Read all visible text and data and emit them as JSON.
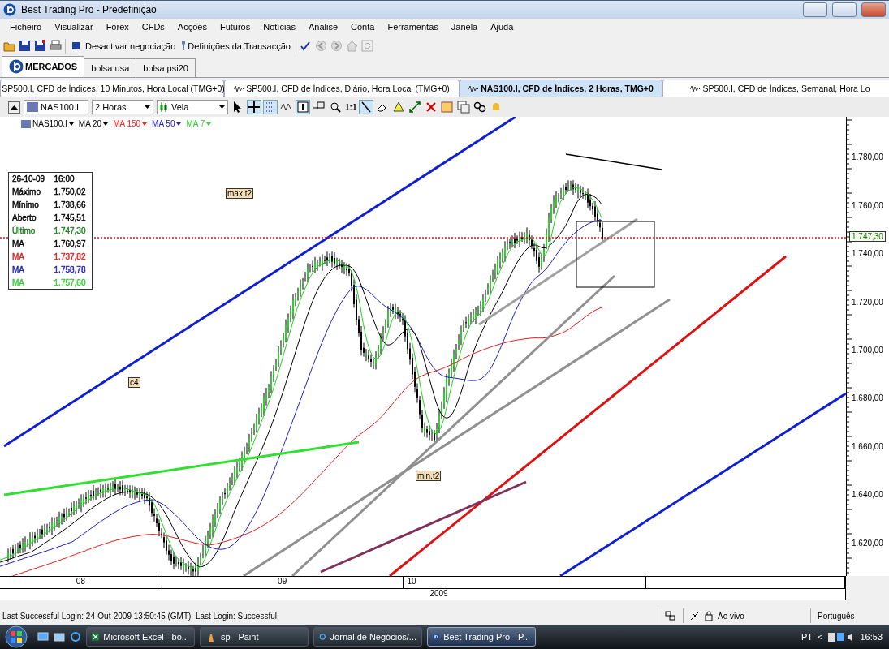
{
  "window": {
    "title": "Best Trading Pro - Predefinição"
  },
  "menu": [
    "Ficheiro",
    "Visualizar",
    "Forex",
    "CFDs",
    "Acções",
    "Futuros",
    "Notícias",
    "Análise",
    "Conta",
    "Ferramentas",
    "Janela",
    "Ajuda"
  ],
  "toolbar": {
    "buttons": [
      {
        "kind": "open"
      },
      {
        "kind": "save"
      },
      {
        "kind": "saveall"
      },
      {
        "kind": "print"
      },
      {
        "kind": "stop",
        "label": "Desactivar negociação"
      },
      {
        "kind": "settings",
        "label": "Definições da Transacção"
      },
      {
        "kind": "check"
      },
      {
        "kind": "back"
      },
      {
        "kind": "forward"
      },
      {
        "kind": "home"
      },
      {
        "kind": "refresh"
      }
    ]
  },
  "market_tabs": [
    {
      "label": "MERCADOS",
      "selected": true
    },
    {
      "label": "bolsa usa",
      "selected": false
    },
    {
      "label": "bolsa psi20",
      "selected": false
    }
  ],
  "chart_tabs": [
    {
      "label": "SP500.I, CFD de Índices, 10 Minutos, Hora Local (TMG+0)",
      "selected": false
    },
    {
      "label": "SP500.I, CFD de Índices, Diário, Hora Local (TMG+0)",
      "selected": false
    },
    {
      "label": "NAS100.I, CFD de Índices, 2 Horas, TMG+0",
      "selected": true
    },
    {
      "label": "SP500.I, CFD de Índices, Semanal, Hora Lo",
      "selected": false
    }
  ],
  "chart_toolbar": {
    "symbol": "NAS100.I",
    "period": "2 Horas",
    "chart_type": "Vela",
    "ratio": "1:1"
  },
  "legend": [
    {
      "label": "NAS100.I",
      "color": "#000000"
    },
    {
      "label": "MA 20",
      "color": "#000000"
    },
    {
      "label": "MA 150",
      "color": "#ff2020"
    },
    {
      "label": "MA 50",
      "color": "#2020d0"
    },
    {
      "label": "MA 7",
      "color": "#30d030"
    }
  ],
  "info_box": {
    "date": "26-10-09",
    "time": "16:00",
    "rows": [
      {
        "label": "Máximo",
        "value": "1.750,02",
        "color": "#000000"
      },
      {
        "label": "Mínimo",
        "value": "1.738,66",
        "color": "#000000"
      },
      {
        "label": "Aberto",
        "value": "1.745,51",
        "color": "#000000"
      },
      {
        "label": "Último",
        "value": "1.747,30",
        "color": "#208020"
      },
      {
        "label": "MA",
        "value": "1.760,97",
        "color": "#000000"
      },
      {
        "label": "MA",
        "value": "1.737,82",
        "color": "#e02020"
      },
      {
        "label": "MA",
        "value": "1.758,78",
        "color": "#2020c0"
      },
      {
        "label": "MA",
        "value": "1.757,60",
        "color": "#30d030"
      }
    ]
  },
  "annotations": [
    {
      "text": "max.t2"
    },
    {
      "text": "c4"
    },
    {
      "text": "min.t2"
    }
  ],
  "y_axis": {
    "labels": [
      "1.780,00",
      "1.760,00",
      "1.740,00",
      "1.720,00",
      "1.700,00",
      "1.680,00",
      "1.660,00",
      "1.640,00",
      "1.620,00"
    ],
    "last_price": "1.747,30"
  },
  "x_axis": {
    "labels": [
      "08",
      "09",
      "10"
    ],
    "year": "2009"
  },
  "status_bar": {
    "message": "Last Successful Login: 24-Out-2009 13:50:45 (GMT)  Last Login: Successful.",
    "mode": "Ao vivo",
    "language": "Português"
  },
  "taskbar": {
    "tasks": [
      {
        "label": "Microsoft Excel - bo...",
        "kind": "excel",
        "selected": false
      },
      {
        "label": "sp - Paint",
        "kind": "paint",
        "selected": false
      },
      {
        "label": "Jornal de Negócios/...",
        "kind": "browser",
        "selected": false
      },
      {
        "label": "Best Trading Pro - P...",
        "kind": "app",
        "selected": true
      }
    ],
    "language": "PT",
    "arrow": "<",
    "clock": "16:53"
  }
}
